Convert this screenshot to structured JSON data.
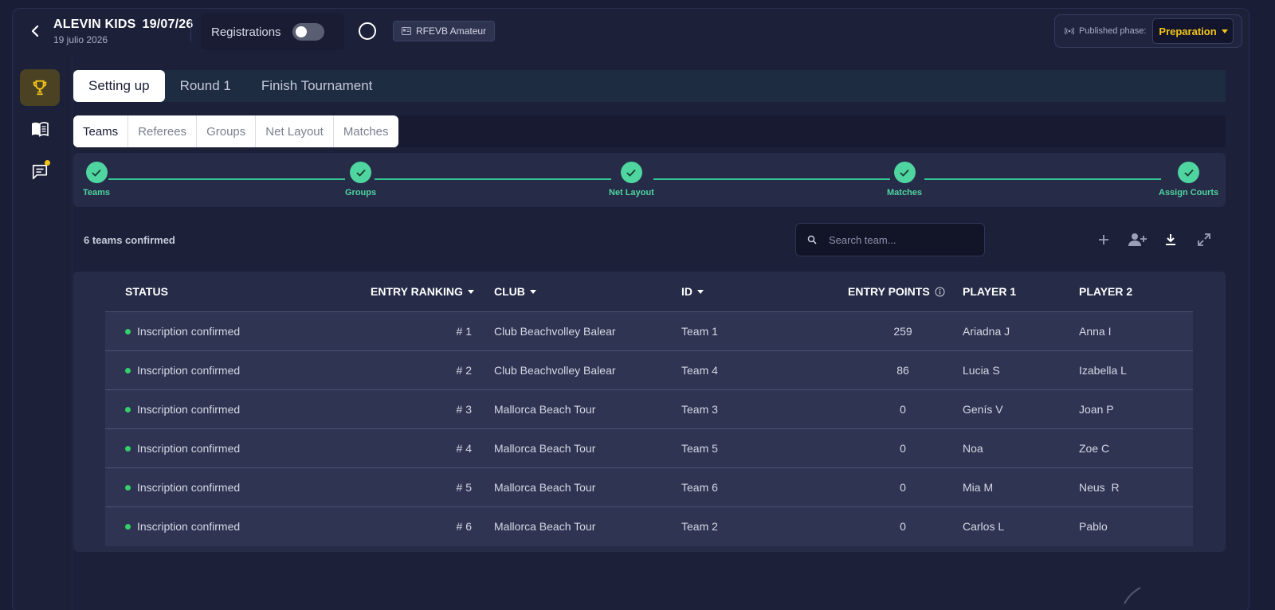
{
  "header": {
    "title": "ALEVIN KIDS",
    "date_short": "19/07/26",
    "date_long": "19 julio 2026",
    "registrations_label": "Registrations",
    "registrations_enabled": false,
    "federation_badge": "RFEVB Amateur",
    "published_phase_label": "Published phase:",
    "published_phase_value": "Preparation"
  },
  "colors": {
    "accent_yellow": "#f5c518",
    "success_green": "#4fd5a0",
    "status_dot": "#33d06a",
    "background": "#1a1d36"
  },
  "sidebar": {
    "items": [
      {
        "icon": "trophy-icon",
        "active": true
      },
      {
        "icon": "book-icon",
        "active": false
      },
      {
        "icon": "chat-icon",
        "active": false,
        "notification": true
      }
    ]
  },
  "main_tabs": [
    {
      "label": "Setting up",
      "active": true
    },
    {
      "label": "Round 1",
      "active": false
    },
    {
      "label": "Finish Tournament",
      "active": false
    }
  ],
  "sub_tabs": [
    {
      "label": "Teams",
      "active": true
    },
    {
      "label": "Referees",
      "active": false
    },
    {
      "label": "Groups",
      "active": false
    },
    {
      "label": "Net Layout",
      "active": false
    },
    {
      "label": "Matches",
      "active": false
    }
  ],
  "stepper": {
    "steps": [
      {
        "label": "Teams",
        "done": true
      },
      {
        "label": "Groups",
        "done": true
      },
      {
        "label": "Net Layout",
        "done": true
      },
      {
        "label": "Matches",
        "done": true
      },
      {
        "label": "Assign Courts",
        "done": true
      }
    ]
  },
  "toolbar": {
    "confirmed_text": "6 teams confirmed",
    "search_placeholder": "Search team...",
    "icons": [
      "add-icon",
      "add-user-icon",
      "download-icon",
      "expand-icon"
    ]
  },
  "table": {
    "headers": {
      "status": "STATUS",
      "entry_ranking": "ENTRY RANKING",
      "club": "CLUB",
      "id": "ID",
      "entry_points": "ENTRY POINTS",
      "player1": "PLAYER 1",
      "player2": "PLAYER 2"
    },
    "rows": [
      {
        "status": "Inscription confirmed",
        "ranking": "# 1",
        "club": "Club Beachvolley Balear",
        "id": "Team 1",
        "points": "259",
        "player1": "Ariadna J",
        "player2": "Anna I"
      },
      {
        "status": "Inscription confirmed",
        "ranking": "# 2",
        "club": "Club Beachvolley Balear",
        "id": "Team 4",
        "points": "86",
        "player1": "Lucia S",
        "player2": "Izabella L"
      },
      {
        "status": "Inscription confirmed",
        "ranking": "# 3",
        "club": "Mallorca Beach Tour",
        "id": "Team 3",
        "points": "0",
        "player1": "Genís V",
        "player2": "Joan P"
      },
      {
        "status": "Inscription confirmed",
        "ranking": "# 4",
        "club": "Mallorca Beach Tour",
        "id": "Team 5",
        "points": "0",
        "player1": "Noa",
        "player2": "Zoe C"
      },
      {
        "status": "Inscription confirmed",
        "ranking": "# 5",
        "club": "Mallorca Beach Tour",
        "id": "Team 6",
        "points": "0",
        "player1": "Mia M",
        "player2": "Neus  R"
      },
      {
        "status": "Inscription confirmed",
        "ranking": "# 6",
        "club": "Mallorca Beach Tour",
        "id": "Team 2",
        "points": "0",
        "player1": "Carlos L",
        "player2": "Pablo"
      }
    ]
  }
}
